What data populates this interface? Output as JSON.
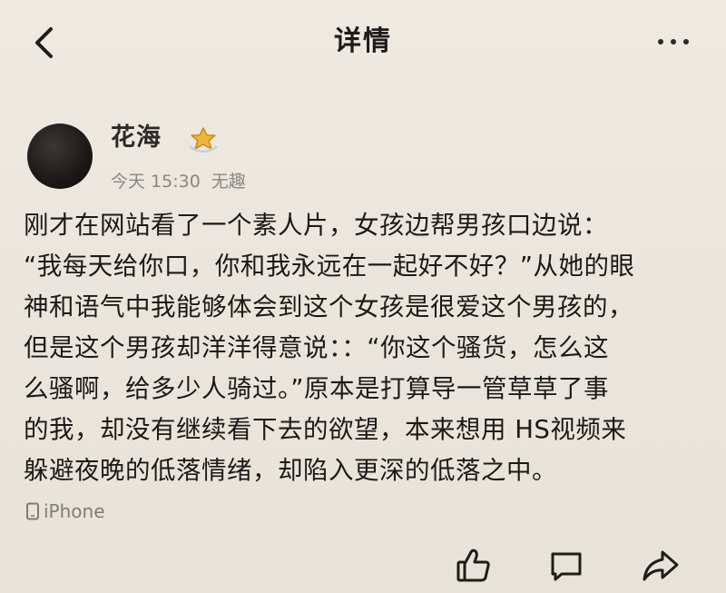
{
  "nav": {
    "title": "详情"
  },
  "post": {
    "author": "花海",
    "time": "今天 15:30",
    "source_tag": "无趣",
    "lines": [
      "刚才在网站看了一个素人片，女孩边帮男孩口边说：",
      "“我每天给你口，你和我永远在一起好不好？”从她的眼",
      "神和语气中我能够体会到这个女孩是很爱这个男孩的，",
      "但是这个男孩却洋洋得意说：：“你这个骚货，怎么这",
      "么骚啊，给多少人骑过。”原本是打算导一管草草了事",
      "的我，却没有继续看下去的欲望，本来想用  HS视频来",
      "躲避夜晚的低落情绪，却陷入更深的低落之中。"
    ],
    "device": "iPhone"
  },
  "icons": {
    "back": "chevron-left-icon",
    "more": "more-dots-icon",
    "badge": "star-badge-icon",
    "device": "phone-icon",
    "like": "thumbs-up-icon",
    "comment": "comment-icon",
    "share": "share-arrow-icon"
  },
  "colors": {
    "background": "#ebe6dd",
    "text": "#1d1c1a",
    "meta": "#8a8782",
    "badge": "#e8a531"
  }
}
